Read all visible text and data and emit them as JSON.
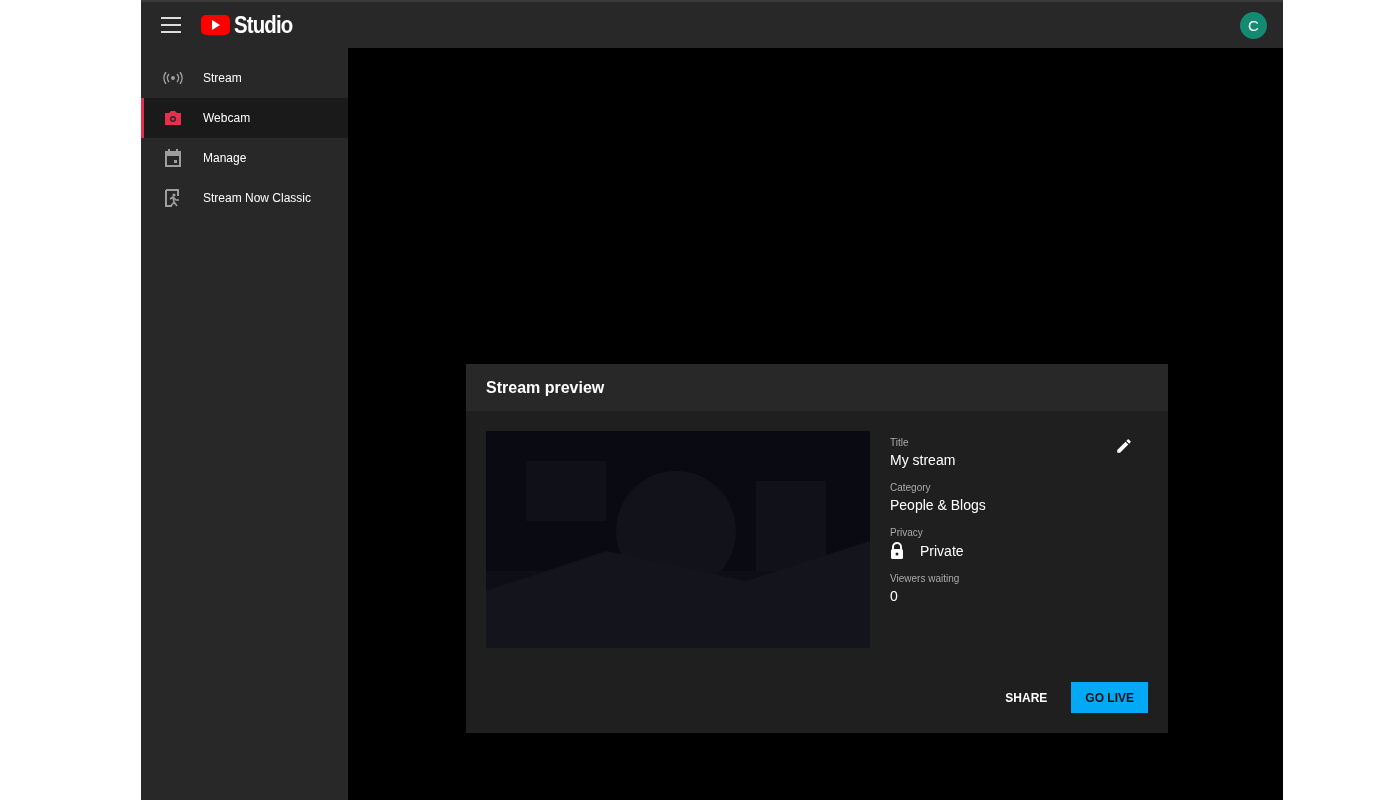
{
  "topbar": {
    "logo_text": "Studio",
    "avatar": "C"
  },
  "sidebar": {
    "items": [
      {
        "label": "Stream",
        "selected": false
      },
      {
        "label": "Webcam",
        "selected": true
      },
      {
        "label": "Manage",
        "selected": false
      },
      {
        "label": "Stream Now Classic",
        "selected": false
      }
    ]
  },
  "dialog": {
    "title": "Stream preview",
    "fields": [
      {
        "kind": "text",
        "label": "Title",
        "value": "My stream"
      },
      {
        "kind": "text",
        "label": "Category",
        "value": "People & Blogs"
      },
      {
        "kind": "locked",
        "label": "Privacy",
        "value": "Private"
      },
      {
        "kind": "text",
        "label": "Viewers waiting",
        "value": "0"
      }
    ],
    "buttons": [
      {
        "label": "SHARE",
        "kind": "text"
      },
      {
        "label": "GO LIVE",
        "kind": "primary"
      }
    ]
  }
}
